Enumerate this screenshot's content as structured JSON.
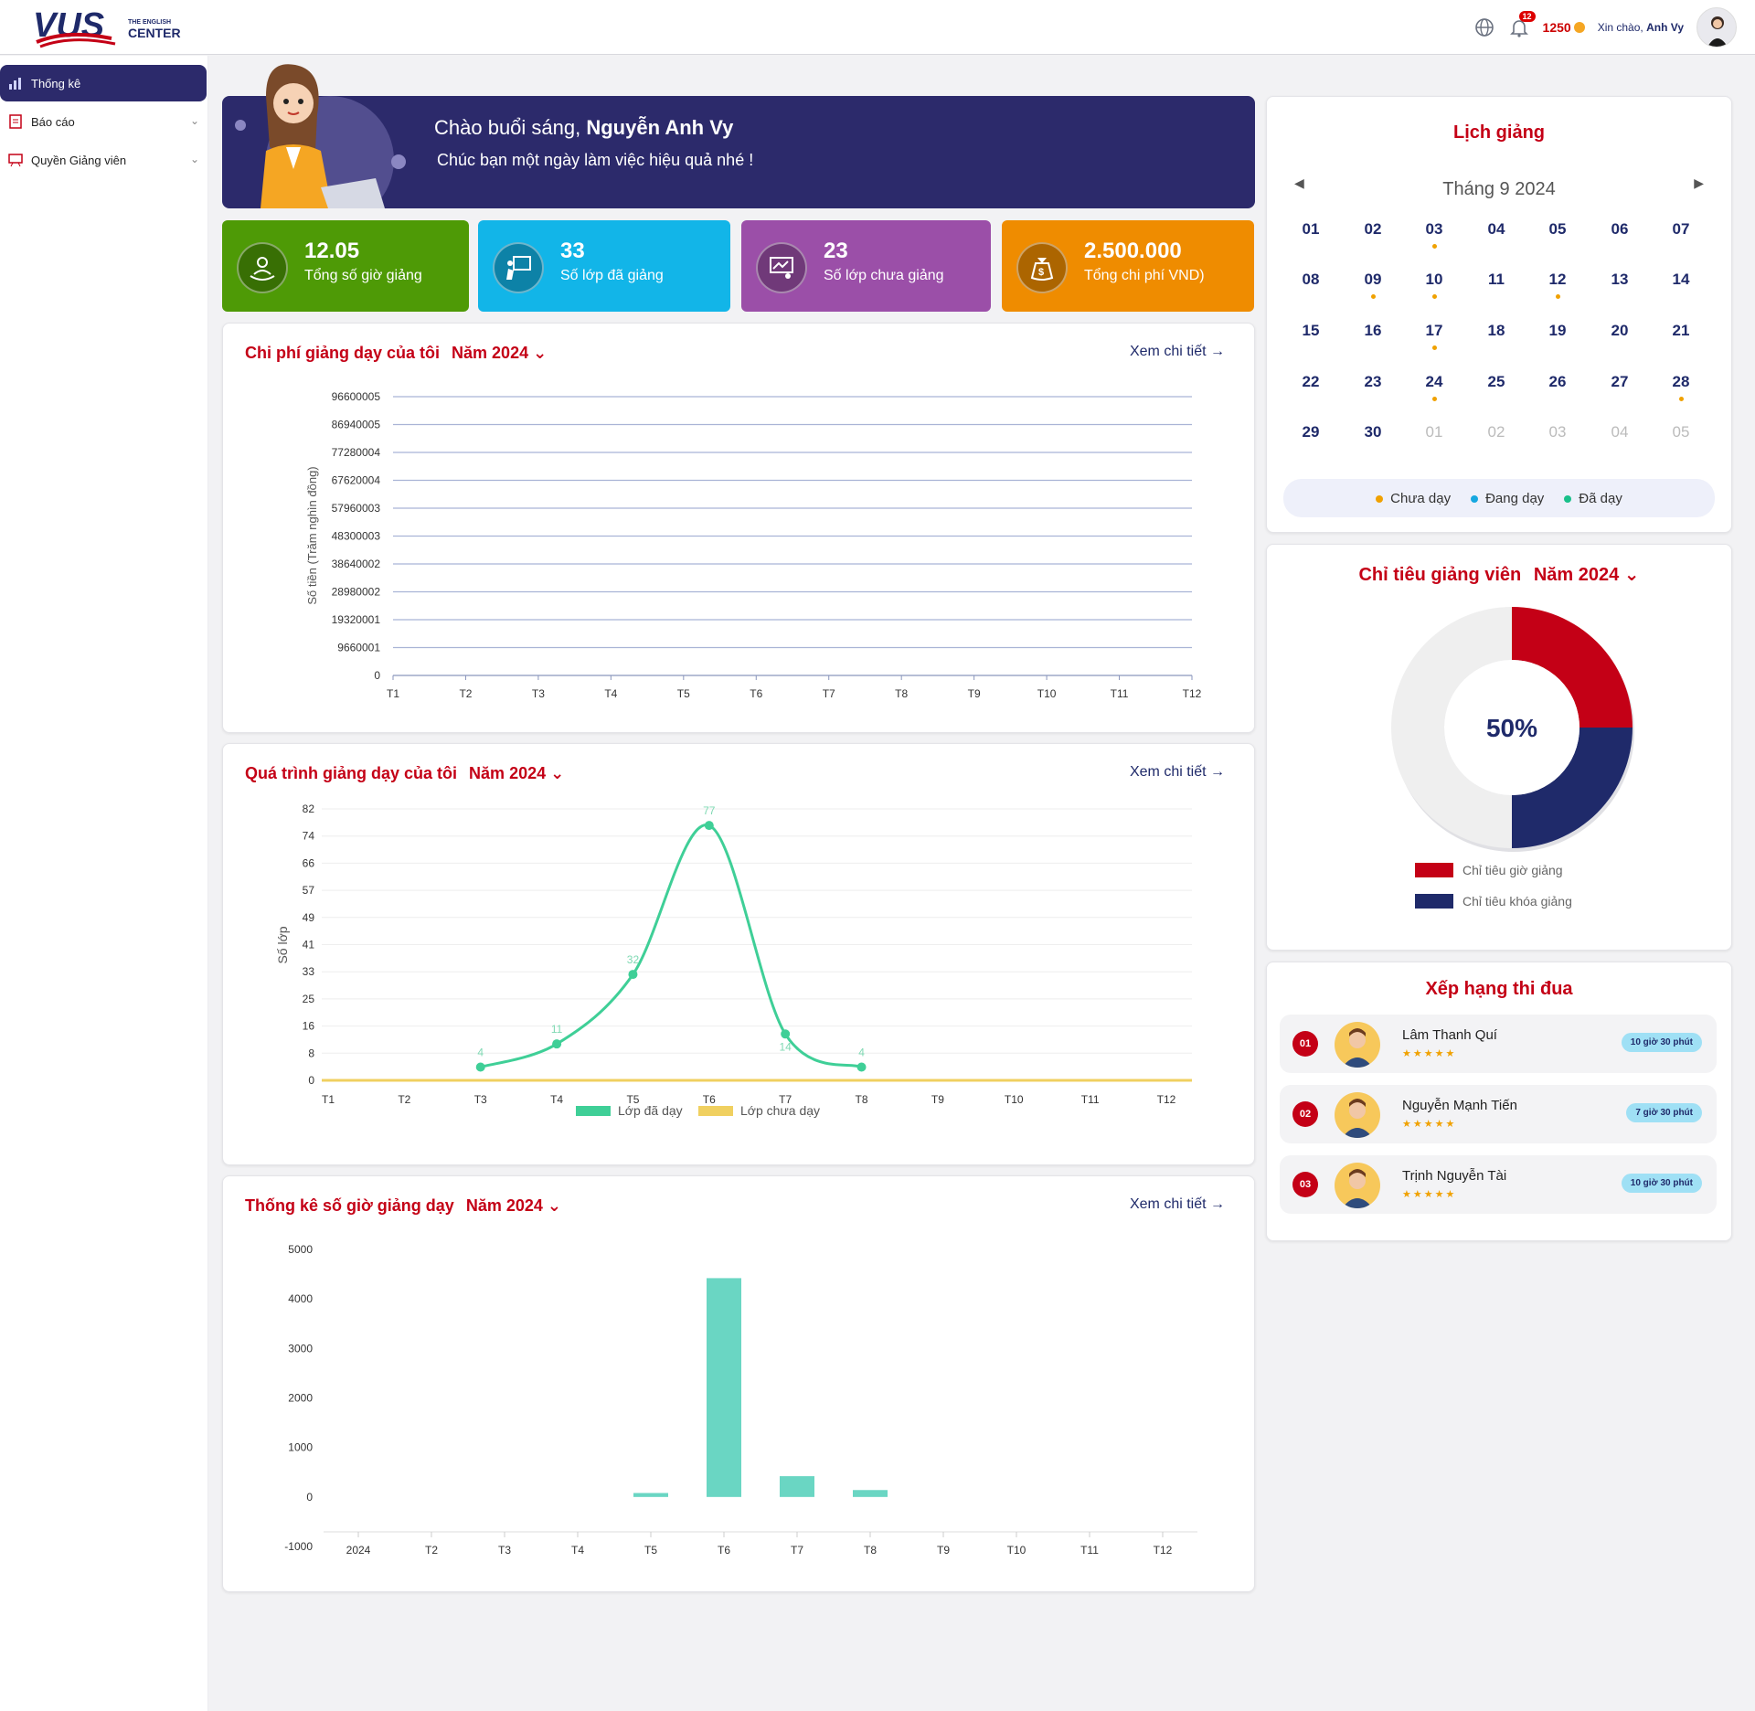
{
  "header": {
    "logo_main": "VUS",
    "logo_small": "THE ENGLISH",
    "logo_center": "CENTER",
    "notif_count": "12",
    "coins": "1250",
    "greeting_prefix": "Xin chào,",
    "greeting_name": "Anh Vy"
  },
  "sidebar": {
    "items": [
      {
        "label": "Thống kê"
      },
      {
        "label": "Báo cáo"
      },
      {
        "label": "Quyền Giảng viên"
      }
    ]
  },
  "banner": {
    "greeting": "Chào buổi sáng,",
    "name": "Nguyễn Anh Vy",
    "subtitle": "Chúc bạn một ngày làm việc hiệu quả nhé !"
  },
  "stats": [
    {
      "value": "12.05",
      "label": "Tổng số giờ giảng",
      "color": "#4e9a06"
    },
    {
      "value": "33",
      "label": "Số lớp đã giảng",
      "color": "#12b5e8"
    },
    {
      "value": "23",
      "label": "Số lớp chưa giảng",
      "color": "#9b4fa8"
    },
    {
      "value": "2.500.000",
      "label": "Tổng chi phí VND)",
      "color": "#ef8c00"
    }
  ],
  "cost_section": {
    "title": "Chi phí giảng dạy của tôi",
    "year": "Năm 2024",
    "link": "Xem chi tiết →"
  },
  "process_section": {
    "title": "Quá trình giảng dạy của tôi",
    "year": "Năm 2024",
    "link": "Xem chi tiết →"
  },
  "hours_section": {
    "title": "Thống kê số giờ giảng dạy",
    "year": "Năm 2024",
    "link": "Xem chi tiết →"
  },
  "calendar": {
    "title": "Lịch giảng",
    "month": "Tháng 9 2024",
    "days": [
      "01",
      "02",
      "03",
      "04",
      "05",
      "06",
      "07",
      "08",
      "09",
      "10",
      "11",
      "12",
      "13",
      "14",
      "15",
      "16",
      "17",
      "18",
      "19",
      "20",
      "21",
      "22",
      "23",
      "24",
      "25",
      "26",
      "27",
      "28",
      "29",
      "30",
      "01",
      "02",
      "03",
      "04",
      "05"
    ],
    "dotted_days": [
      "03",
      "09",
      "10",
      "12",
      "17",
      "24",
      "28"
    ],
    "legend": [
      {
        "label": "Chưa dạy",
        "color": "#f0a100"
      },
      {
        "label": "Đang dạy",
        "color": "#16a7e0"
      },
      {
        "label": "Đã dạy",
        "color": "#19c08a"
      }
    ]
  },
  "target": {
    "title": "Chỉ tiêu giảng viên",
    "year": "Năm 2024",
    "percent": "50%",
    "legend": [
      {
        "label": "Chỉ tiêu giờ giảng",
        "color": "#c40016"
      },
      {
        "label": "Chỉ tiêu khóa giảng",
        "color": "#1f2a6a"
      }
    ]
  },
  "ranking": {
    "title": "Xếp hạng thi đua",
    "rows": [
      {
        "rank": "01",
        "name": "Lâm Thanh Quí",
        "stars": "★★★★★",
        "badge": "10 giờ 30 phút"
      },
      {
        "rank": "02",
        "name": "Nguyễn Mạnh Tiến",
        "stars": "★★★★★",
        "badge": "7 giờ 30 phút"
      },
      {
        "rank": "03",
        "name": "Trịnh Nguyễn Tài",
        "stars": "★★★★★",
        "badge": "10 giờ 30 phút"
      }
    ]
  },
  "chart_data": [
    {
      "type": "line",
      "title": "Chi phí giảng dạy của tôi",
      "ylabel": "Số tiền (Trăm nghìn đồng)",
      "categories": [
        "T1",
        "T2",
        "T3",
        "T4",
        "T5",
        "T6",
        "T7",
        "T8",
        "T9",
        "T10",
        "T11",
        "T12"
      ],
      "yticks": [
        "96600005",
        "86940005",
        "77280004",
        "67620004",
        "57960003",
        "48300003",
        "38640002",
        "28980002",
        "19320001",
        "9660001",
        "0"
      ],
      "series": [],
      "grid": true
    },
    {
      "type": "line",
      "title": "Quá trình giảng dạy của tôi",
      "ylabel": "Số lớp",
      "categories": [
        "T1",
        "T2",
        "T3",
        "T4",
        "T5",
        "T6",
        "T7",
        "T8",
        "T9",
        "T10",
        "T11",
        "T12"
      ],
      "yticks": [
        "82",
        "74",
        "66",
        "57",
        "49",
        "41",
        "33",
        "25",
        "16",
        "8",
        "0"
      ],
      "ylim": [
        0,
        82
      ],
      "series": [
        {
          "name": "Lớp đã dạy",
          "color": "#3fcf97",
          "values": [
            null,
            null,
            4,
            11,
            32,
            77,
            14,
            4,
            null,
            null,
            null,
            null
          ]
        },
        {
          "name": "Lớp chưa dạy",
          "color": "#f0d060",
          "values": [
            0,
            0,
            0,
            0,
            0,
            0,
            0,
            0,
            0,
            0,
            0,
            0
          ]
        }
      ],
      "legend": "bottom"
    },
    {
      "type": "bar",
      "title": "Thống kê số giờ giảng dạy",
      "categories": [
        "2024",
        "T2",
        "T3",
        "T4",
        "T5",
        "T6",
        "T7",
        "T8",
        "T9",
        "T10",
        "T11",
        "T12"
      ],
      "yticks": [
        "5000",
        "4000",
        "3000",
        "2000",
        "1000",
        "0",
        "-1000"
      ],
      "ylim": [
        -1000,
        5000
      ],
      "values": [
        0,
        0,
        0,
        0,
        80,
        4420,
        420,
        140,
        0,
        0,
        0,
        0
      ],
      "color": "#6ad6c3"
    },
    {
      "type": "pie",
      "title": "Chỉ tiêu giảng viên",
      "slices": [
        {
          "name": "Chỉ tiêu giờ giảng",
          "value": 25,
          "color": "#c40016"
        },
        {
          "name": "Chỉ tiêu khóa giảng",
          "value": 25,
          "color": "#1f2a6a"
        },
        {
          "name": "",
          "value": 50,
          "color": "#efefef"
        }
      ]
    }
  ]
}
